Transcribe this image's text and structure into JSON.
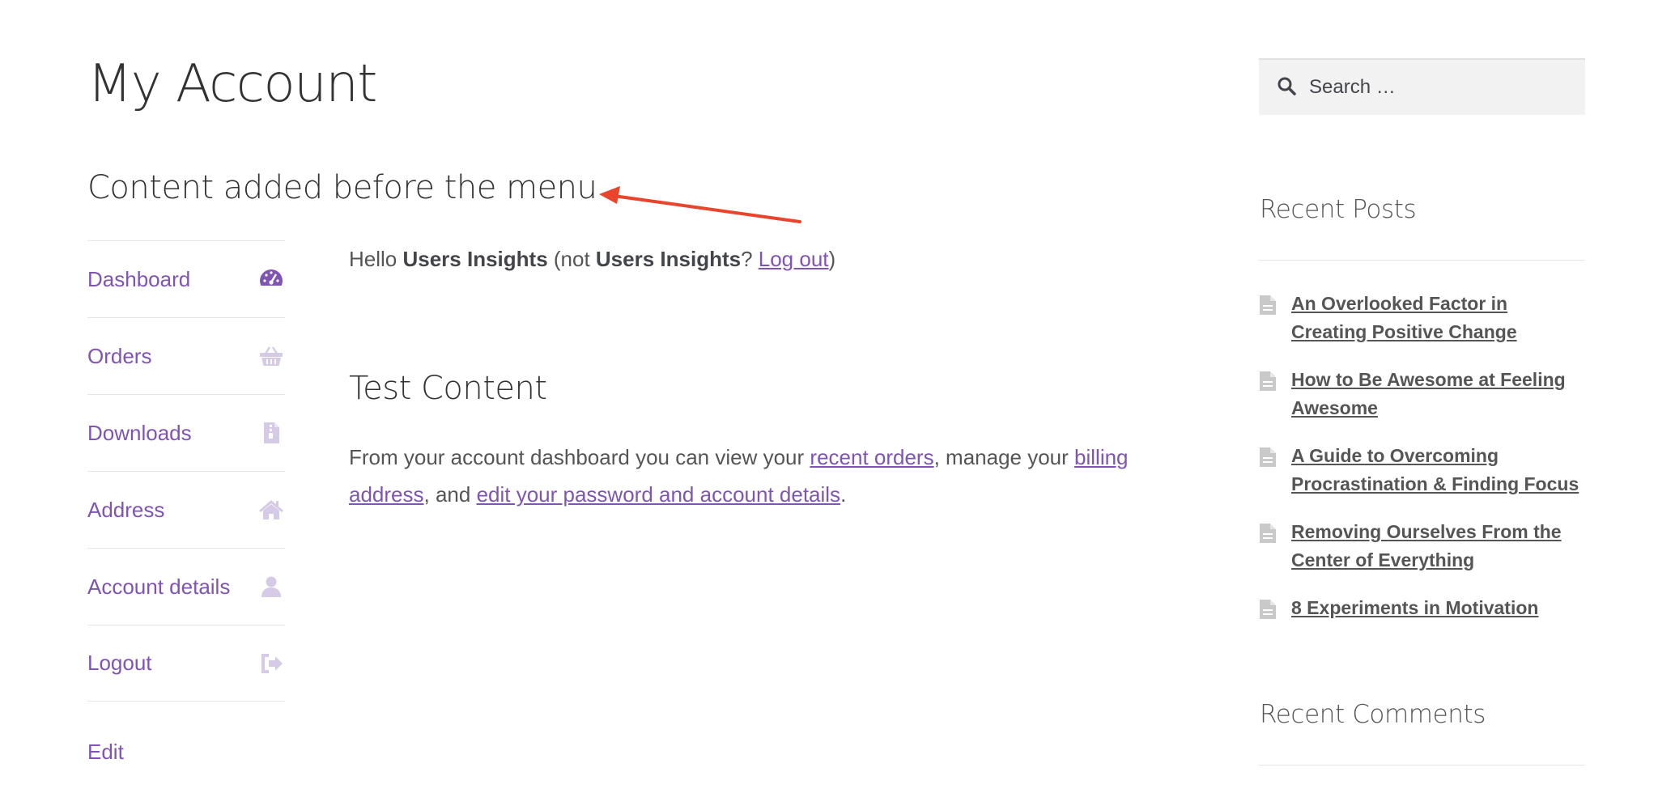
{
  "page": {
    "title": "My Account",
    "before_menu": "Content added before the menu"
  },
  "nav": {
    "items": [
      {
        "label": "Dashboard",
        "icon": "dashboard-icon"
      },
      {
        "label": "Orders",
        "icon": "basket-icon"
      },
      {
        "label": "Downloads",
        "icon": "file-download-icon"
      },
      {
        "label": "Address",
        "icon": "home-icon"
      },
      {
        "label": "Account details",
        "icon": "user-icon"
      },
      {
        "label": "Logout",
        "icon": "sign-out-icon"
      }
    ],
    "edit_label": "Edit"
  },
  "main": {
    "hello_prefix": "Hello ",
    "username": "Users Insights",
    "not_text": " (not ",
    "username2": "Users Insights",
    "question": "? ",
    "logout_link": "Log out",
    "close_paren": ")",
    "test_title": "Test Content",
    "desc_1": "From your account dashboard you can view your ",
    "recent_orders": "recent orders",
    "desc_2": ", manage your ",
    "billing_address": "billing address",
    "desc_3": ", and ",
    "edit_password": "edit your password and account details",
    "desc_4": "."
  },
  "sidebar": {
    "search_placeholder": "Search …",
    "recent_posts_title": "Recent Posts",
    "posts": [
      "An Overlooked Factor in Creating Positive Change",
      "How to Be Awesome at Feeling Awesome",
      "A Guide to Overcoming Procrastination & Finding Focus",
      "Removing Ourselves From the Center of Everything",
      "8 Experiments in Motivation"
    ],
    "recent_comments_title": "Recent Comments"
  },
  "colors": {
    "accent": "#7f54b3",
    "arrow": "#e8452c"
  }
}
